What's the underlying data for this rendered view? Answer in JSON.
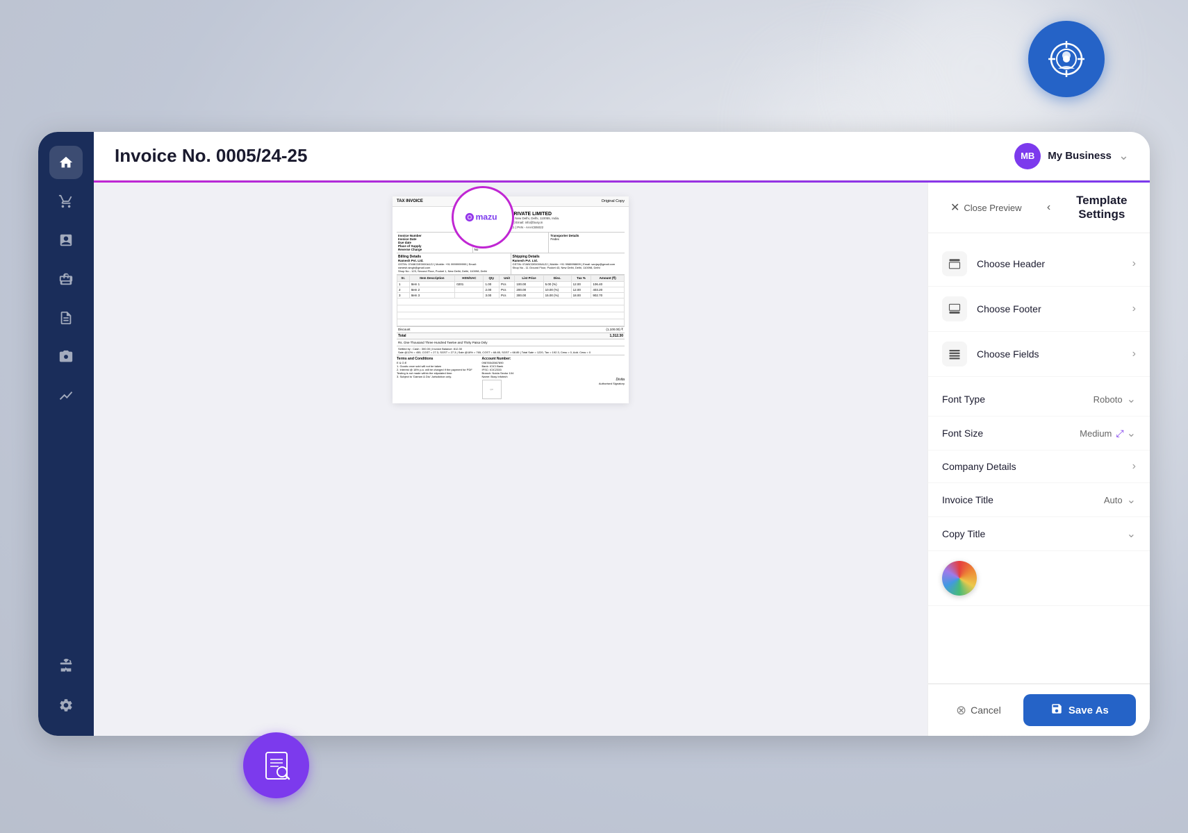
{
  "app": {
    "title": "Invoice No. 0005/24-25",
    "business_name": "My Business",
    "business_initials": "MB"
  },
  "sidebar": {
    "items": [
      {
        "id": "home",
        "icon": "⌂",
        "label": "Home",
        "active": true
      },
      {
        "id": "cart",
        "icon": "🛒",
        "label": "Cart"
      },
      {
        "id": "reports",
        "icon": "📊",
        "label": "Reports"
      },
      {
        "id": "box",
        "icon": "📦",
        "label": "Products"
      },
      {
        "id": "document",
        "icon": "📄",
        "label": "Documents"
      },
      {
        "id": "camera",
        "icon": "📷",
        "label": "Camera"
      },
      {
        "id": "chart",
        "icon": "📈",
        "label": "Analytics"
      },
      {
        "id": "briefcase",
        "icon": "💼",
        "label": "Business"
      },
      {
        "id": "settings",
        "icon": "⚙",
        "label": "Settings"
      }
    ]
  },
  "invoice": {
    "number": "0005/24-25",
    "type": "TAX INVOICE",
    "copy_type": "Original Copy",
    "company_name": "BUSY INFOTECH PRIVATE LIMITED",
    "company_address": "Jhansi Road New Delhi Central Delhi, New Delhi, Delhi, 110055, India.",
    "company_mobile": "Mobile: +91 8800028282",
    "company_email": "Email: info@busy.in",
    "company_gstin": "GSTIN - 07AACB50221Z1",
    "company_pan": "PAN - AAACB5022",
    "invoice_number": "0001/24-25",
    "invoice_date": "01-Dec-24",
    "due_date": "31-Dec-24",
    "place_supply": "Delhi",
    "reverse_charge": "No",
    "transporter": "Fedex",
    "billing_details_title": "Billing Details",
    "billing_company": "Ramesh Pvt. Ltd.",
    "billing_gstin": "GSTIN: 07ABCDE0000A1ZJ",
    "billing_mobile": "Mobile: +91 9999999999",
    "billing_email": "Email: ramesh.singh@gmail.com",
    "billing_address": "Shop No - 123, Second Floor, Pocket 1, New Delhi, Delhi, 110098, Delhi",
    "shipping_details_title": "Shipping Details",
    "shipping_company": "Ramesh Pvt. Ltd.",
    "shipping_gstin": "GSTIN: 07ABCDE0000A1ZJ",
    "shipping_mobile": "Mobile: +91 9988998899",
    "shipping_email": "Email: sanjay@gmail.com",
    "shipping_address": "Shop No - 11 Ground Floor, Pocket 43, New Delhi, Delhi, 110098, Delhi",
    "items": [
      {
        "sr": "1",
        "name": "Item 1",
        "hsn": "0201",
        "qty": "1.00",
        "unit": "Pcs",
        "price": "100.00",
        "disc": "5.00 (%)",
        "tax": "12.00",
        "amount": "106.40"
      },
      {
        "sr": "2",
        "name": "Item 2",
        "hsn": "",
        "qty": "2.00",
        "unit": "Pcs",
        "price": "200.00",
        "disc": "10.00 (%)",
        "tax": "12.00",
        "amount": "403.20"
      },
      {
        "sr": "3",
        "name": "Item 3",
        "hsn": "",
        "qty": "3.00",
        "unit": "Pcs",
        "price": "300.00",
        "disc": "15.00 (%)",
        "tax": "18.00",
        "amount": "902.70"
      }
    ],
    "discount_label": "Discount",
    "discount_value": "(1,100.00) ₹",
    "total_label": "Total",
    "total_value": "1,312.30",
    "amount_words": "Rs. One Thousand Three Hundred Twelve and Thirty Paisa Only",
    "settled_by": "Settled by : Cash : 300.00 | Invoice Balance: 812.30",
    "sale_note": "Sale @12% = 455, CGST = 27.3, SGST = 27.3 | Sale @18% = 765, CGST = 68.85, SGST = 68.85 | Total Sale = 1220, Tax = 192.3, Cess = 0, Add. Cess = 0",
    "terms_title": "Terms and Conditions",
    "terms": "E & O.E\n1. Goods once sold will not be taken\n2. Interest @ 18% p.a. will be charged if the payment for PDF Testing is not made within the stipulated time.\n3. Subject to 'Daman & Diu' Jurisdiction only.",
    "account_title": "Account Number:",
    "account_number": "09876543567890",
    "bank_name": "Bank: ICICI Bank",
    "ifsc": "IFSC: ICIC2333",
    "branch": "Branch: Noida Sector 104",
    "name": "Name: Busy Infotech",
    "signatory": "Authorised Signatory"
  },
  "panel": {
    "close_preview_label": "Close Preview",
    "title": "Template Settings",
    "back_icon": "‹",
    "sections": [
      {
        "id": "header",
        "icon": "📱",
        "label": "Choose Header"
      },
      {
        "id": "footer",
        "icon": "📱",
        "label": "Choose Footer"
      },
      {
        "id": "fields",
        "icon": "📋",
        "label": "Choose Fields"
      }
    ],
    "settings": [
      {
        "id": "font_type",
        "label": "Font Type",
        "value": "Roboto"
      },
      {
        "id": "font_size",
        "label": "Font Size",
        "value": "Medium"
      },
      {
        "id": "company_details",
        "label": "Company Details",
        "value": ""
      },
      {
        "id": "invoice_title",
        "label": "Invoice Title",
        "value": "Auto"
      },
      {
        "id": "copy_title",
        "label": "Copy Title",
        "value": ""
      }
    ]
  },
  "footer": {
    "cancel_label": "Cancel",
    "save_as_label": "Save As"
  }
}
